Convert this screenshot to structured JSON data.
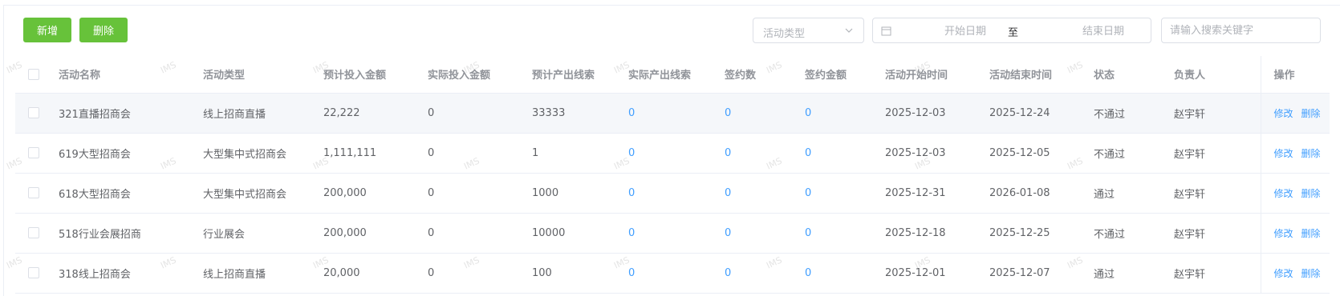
{
  "toolbar": {
    "add_label": "新增",
    "delete_label": "删除",
    "type_select_placeholder": "活动类型",
    "date_start_placeholder": "开始日期",
    "date_separator": "至",
    "date_end_placeholder": "结束日期",
    "search_placeholder": "请输入搜索关键字"
  },
  "table": {
    "columns": [
      "活动名称",
      "活动类型",
      "预计投入金额",
      "实际投入金额",
      "预计产出线索",
      "实际产出线索",
      "签约数",
      "签约金额",
      "活动开始时间",
      "活动结束时间",
      "状态",
      "负责人",
      "操作"
    ],
    "rows": [
      {
        "name": "321直播招商会",
        "type": "线上招商直播",
        "planned_cost": "22,222",
        "actual_cost": "0",
        "planned_leads": "33333",
        "actual_leads": "0",
        "signed": "0",
        "signed_amount": "0",
        "start": "2025-12-03",
        "end": "2025-12-24",
        "status": "不通过",
        "owner": "赵宇轩"
      },
      {
        "name": "619大型招商会",
        "type": "大型集中式招商会",
        "planned_cost": "1,111,111",
        "actual_cost": "0",
        "planned_leads": "1",
        "actual_leads": "0",
        "signed": "0",
        "signed_amount": "0",
        "start": "2025-12-03",
        "end": "2025-12-05",
        "status": "不通过",
        "owner": "赵宇轩"
      },
      {
        "name": "618大型招商会",
        "type": "大型集中式招商会",
        "planned_cost": "200,000",
        "actual_cost": "0",
        "planned_leads": "1000",
        "actual_leads": "0",
        "signed": "0",
        "signed_amount": "0",
        "start": "2025-12-31",
        "end": "2026-01-08",
        "status": "通过",
        "owner": "赵宇轩"
      },
      {
        "name": "518行业会展招商",
        "type": "行业展会",
        "planned_cost": "200,000",
        "actual_cost": "0",
        "planned_leads": "10000",
        "actual_leads": "0",
        "signed": "0",
        "signed_amount": "0",
        "start": "2025-12-18",
        "end": "2025-12-25",
        "status": "不通过",
        "owner": "赵宇轩"
      },
      {
        "name": "318线上招商会",
        "type": "线上招商直播",
        "planned_cost": "20,000",
        "actual_cost": "0",
        "planned_leads": "100",
        "actual_leads": "0",
        "signed": "0",
        "signed_amount": "0",
        "start": "2025-12-01",
        "end": "2025-12-07",
        "status": "通过",
        "owner": "赵宇轩"
      }
    ],
    "edit_label": "修改",
    "delete_label": "删除"
  },
  "watermark": "IMS",
  "colors": {
    "primary_green": "#67c23a",
    "link_blue": "#409eff",
    "header_text": "#909399",
    "body_text": "#606266"
  }
}
